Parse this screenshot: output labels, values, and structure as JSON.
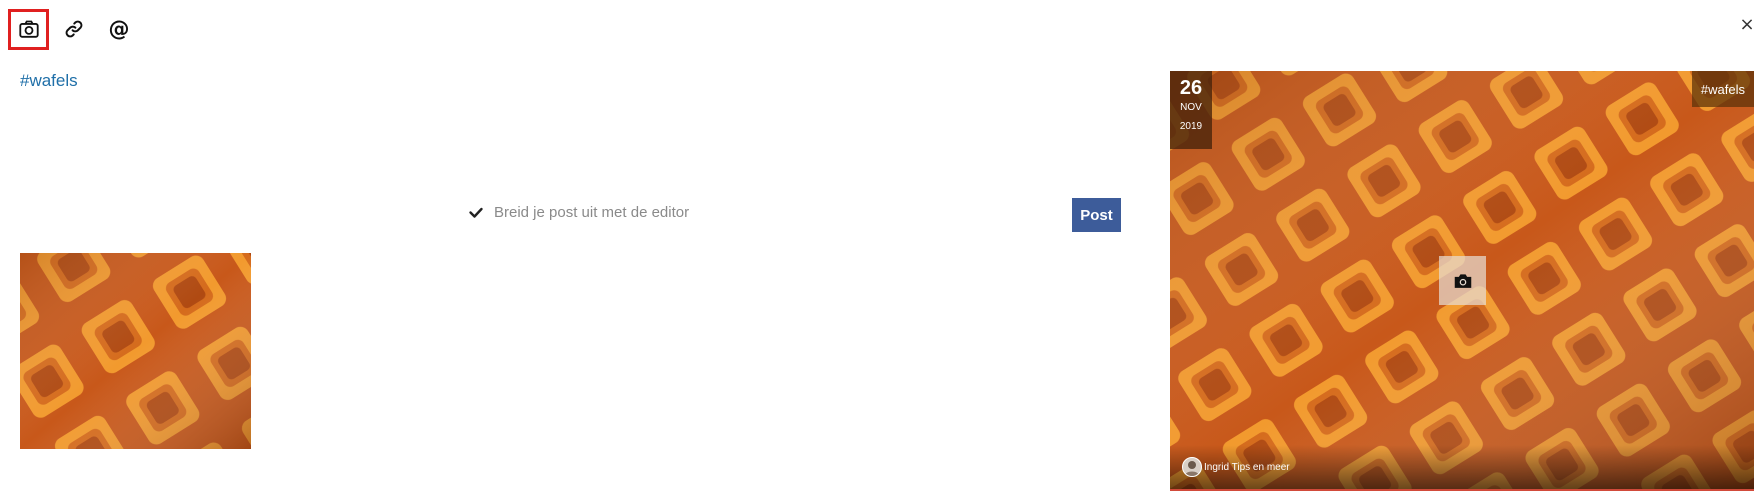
{
  "toolbar": {
    "photo_icon": "camera-icon",
    "link_icon": "link-icon",
    "mention_label": "@"
  },
  "close_label": "×",
  "hashtag": "#wafels",
  "editor": {
    "expand_label": "Breid je post uit met de editor",
    "post_label": "Post"
  },
  "preview": {
    "day": "26",
    "month": "NOV",
    "year": "2019",
    "tag": "#wafels",
    "author": "Ingrid Tips en meer"
  },
  "colors": {
    "post_button": "#3d5c9a",
    "active_outline": "#e02020",
    "hashtag_link": "#1f6fa8"
  }
}
